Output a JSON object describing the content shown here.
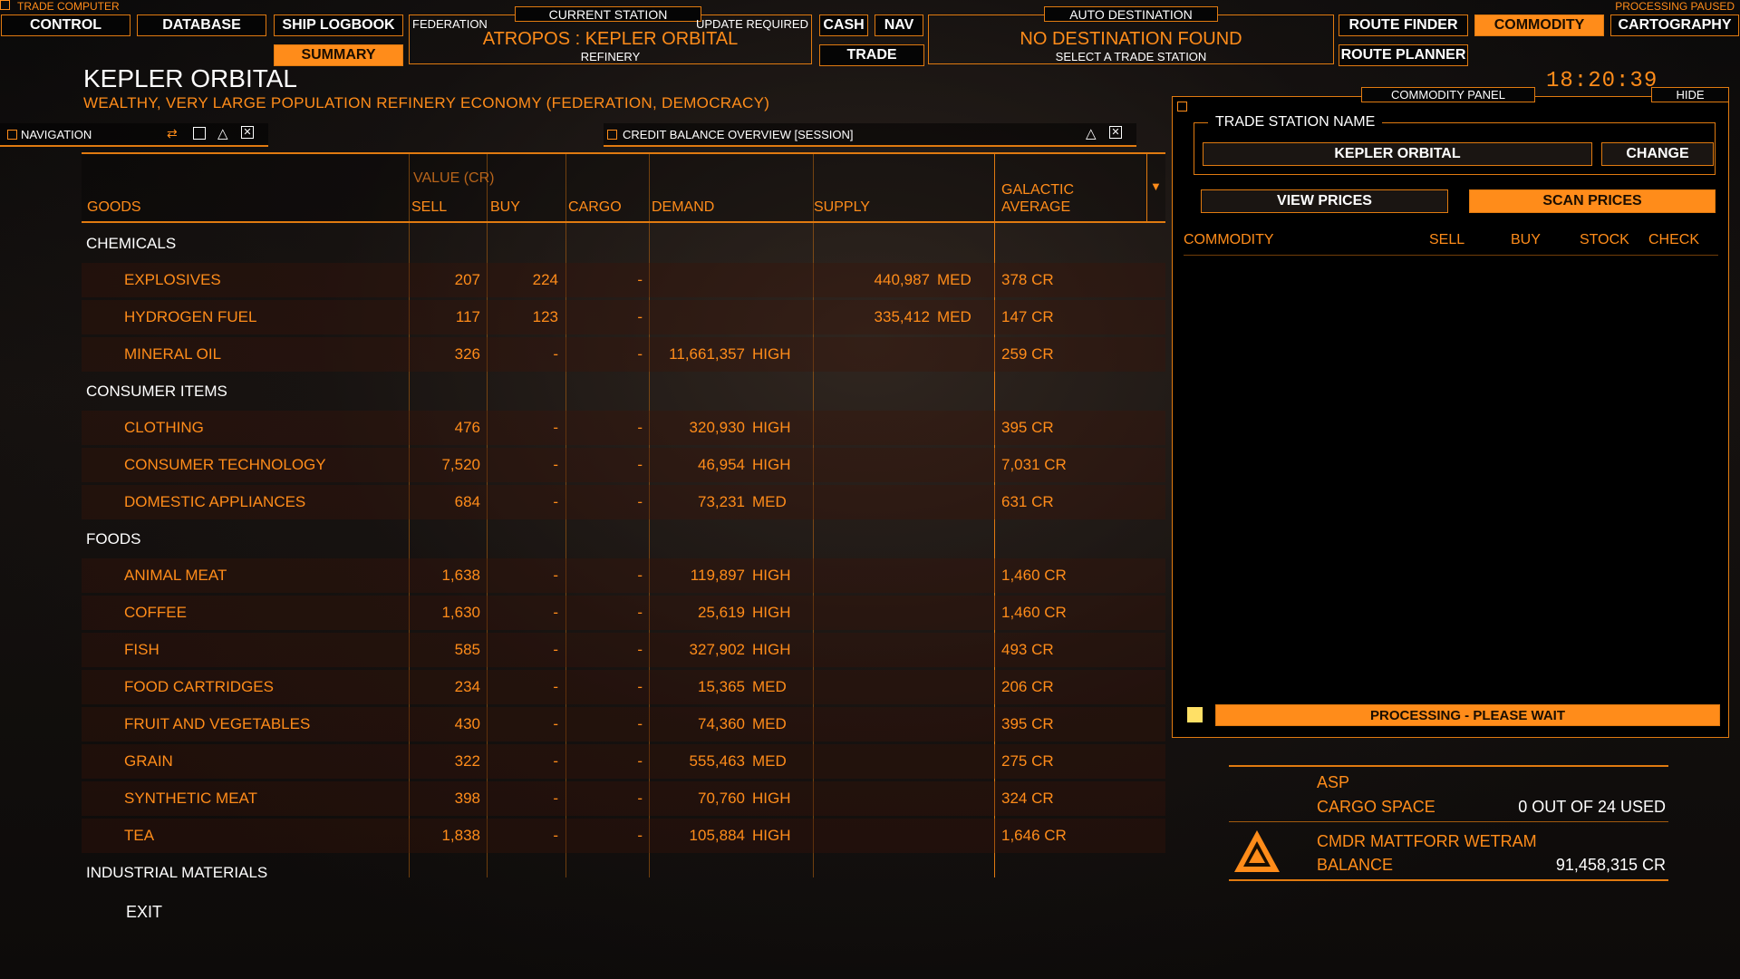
{
  "top": {
    "trade_computer": "TRADE COMPUTER",
    "processing_paused": "PROCESSING PAUSED",
    "nav_left": [
      "CONTROL",
      "DATABASE",
      "SHIP LOGBOOK"
    ],
    "summary": "SUMMARY",
    "current_station": {
      "label": "CURRENT STATION",
      "faction": "FEDERATION",
      "status": "UPDATE REQUIRED",
      "name": "ATROPOS : KEPLER ORBITAL",
      "type": "REFINERY"
    },
    "cash": "CASH",
    "nav": "NAV",
    "trade": "TRADE",
    "auto_destination": {
      "label": "AUTO DESTINATION",
      "value": "NO DESTINATION FOUND",
      "hint": "SELECT A TRADE STATION"
    },
    "route_finder": "ROUTE FINDER",
    "commodity": "COMMODITY",
    "cartography": "CARTOGRAPHY",
    "route_planner": "ROUTE PLANNER"
  },
  "station": {
    "title": "KEPLER ORBITAL",
    "subtitle": "WEALTHY, VERY LARGE POPULATION REFINERY ECONOMY (FEDERATION, DEMOCRACY)",
    "clock": "18:20:39"
  },
  "windows": {
    "navigation": "NAVIGATION",
    "credit_balance": "CREDIT BALANCE OVERVIEW [SESSION]"
  },
  "table": {
    "value_header": "VALUE (CR)",
    "headers": {
      "goods": "GOODS",
      "sell": "SELL",
      "buy": "BUY",
      "cargo": "CARGO",
      "demand": "DEMAND",
      "supply": "SUPPLY",
      "galactic_1": "GALACTIC",
      "galactic_2": "AVERAGE"
    },
    "rows": [
      {
        "kind": "cat",
        "name": "CHEMICALS"
      },
      {
        "kind": "item",
        "name": "EXPLOSIVES",
        "sell": "207",
        "buy": "224",
        "cargo": "-",
        "demand": "",
        "demand_level": "",
        "supply": "440,987",
        "supply_level": "MED",
        "avg": "378 CR"
      },
      {
        "kind": "item",
        "name": "HYDROGEN FUEL",
        "sell": "117",
        "buy": "123",
        "cargo": "-",
        "demand": "",
        "demand_level": "",
        "supply": "335,412",
        "supply_level": "MED",
        "avg": "147 CR"
      },
      {
        "kind": "item",
        "name": "MINERAL OIL",
        "sell": "326",
        "buy": "-",
        "cargo": "-",
        "demand": "11,661,357",
        "demand_level": "HIGH",
        "supply": "",
        "supply_level": "",
        "avg": "259 CR"
      },
      {
        "kind": "cat",
        "name": "CONSUMER ITEMS"
      },
      {
        "kind": "item",
        "name": "CLOTHING",
        "sell": "476",
        "buy": "-",
        "cargo": "-",
        "demand": "320,930",
        "demand_level": "HIGH",
        "supply": "",
        "supply_level": "",
        "avg": "395 CR"
      },
      {
        "kind": "item",
        "name": "CONSUMER TECHNOLOGY",
        "sell": "7,520",
        "buy": "-",
        "cargo": "-",
        "demand": "46,954",
        "demand_level": "HIGH",
        "supply": "",
        "supply_level": "",
        "avg": "7,031 CR"
      },
      {
        "kind": "item",
        "name": "DOMESTIC APPLIANCES",
        "sell": "684",
        "buy": "-",
        "cargo": "-",
        "demand": "73,231",
        "demand_level": "MED",
        "supply": "",
        "supply_level": "",
        "avg": "631 CR"
      },
      {
        "kind": "cat",
        "name": "FOODS"
      },
      {
        "kind": "item",
        "name": "ANIMAL MEAT",
        "sell": "1,638",
        "buy": "-",
        "cargo": "-",
        "demand": "119,897",
        "demand_level": "HIGH",
        "supply": "",
        "supply_level": "",
        "avg": "1,460 CR"
      },
      {
        "kind": "item",
        "name": "COFFEE",
        "sell": "1,630",
        "buy": "-",
        "cargo": "-",
        "demand": "25,619",
        "demand_level": "HIGH",
        "supply": "",
        "supply_level": "",
        "avg": "1,460 CR"
      },
      {
        "kind": "item",
        "name": "FISH",
        "sell": "585",
        "buy": "-",
        "cargo": "-",
        "demand": "327,902",
        "demand_level": "HIGH",
        "supply": "",
        "supply_level": "",
        "avg": "493 CR"
      },
      {
        "kind": "item",
        "name": "FOOD CARTRIDGES",
        "sell": "234",
        "buy": "-",
        "cargo": "-",
        "demand": "15,365",
        "demand_level": "MED",
        "supply": "",
        "supply_level": "",
        "avg": "206 CR"
      },
      {
        "kind": "item",
        "name": "FRUIT AND VEGETABLES",
        "sell": "430",
        "buy": "-",
        "cargo": "-",
        "demand": "74,360",
        "demand_level": "MED",
        "supply": "",
        "supply_level": "",
        "avg": "395 CR"
      },
      {
        "kind": "item",
        "name": "GRAIN",
        "sell": "322",
        "buy": "-",
        "cargo": "-",
        "demand": "555,463",
        "demand_level": "MED",
        "supply": "",
        "supply_level": "",
        "avg": "275 CR"
      },
      {
        "kind": "item",
        "name": "SYNTHETIC MEAT",
        "sell": "398",
        "buy": "-",
        "cargo": "-",
        "demand": "70,760",
        "demand_level": "HIGH",
        "supply": "",
        "supply_level": "",
        "avg": "324 CR"
      },
      {
        "kind": "item",
        "name": "TEA",
        "sell": "1,838",
        "buy": "-",
        "cargo": "-",
        "demand": "105,884",
        "demand_level": "HIGH",
        "supply": "",
        "supply_level": "",
        "avg": "1,646 CR"
      },
      {
        "kind": "cat",
        "name": "INDUSTRIAL MATERIALS"
      }
    ]
  },
  "exit": "EXIT",
  "panel": {
    "title": "COMMODITY PANEL",
    "hide": "HIDE",
    "trade_station_label": "TRADE STATION NAME",
    "station_value": "KEPLER ORBITAL",
    "change": "CHANGE",
    "view_prices": "VIEW PRICES",
    "scan_prices": "SCAN PRICES",
    "columns": [
      "COMMODITY",
      "SELL",
      "BUY",
      "STOCK",
      "CHECK"
    ],
    "processing": "PROCESSING - PLEASE WAIT"
  },
  "ship": {
    "name": "ASP",
    "cargo_label": "CARGO SPACE",
    "cargo_value": "0 OUT OF 24 USED",
    "cmdr": "CMDR MATTFORR WETRAM",
    "balance_label": "BALANCE",
    "balance_value": "91,458,315 CR"
  },
  "colors": {
    "accent": "#ff8c1a",
    "line": "#e07a10",
    "processing_square": "#ffe066"
  }
}
